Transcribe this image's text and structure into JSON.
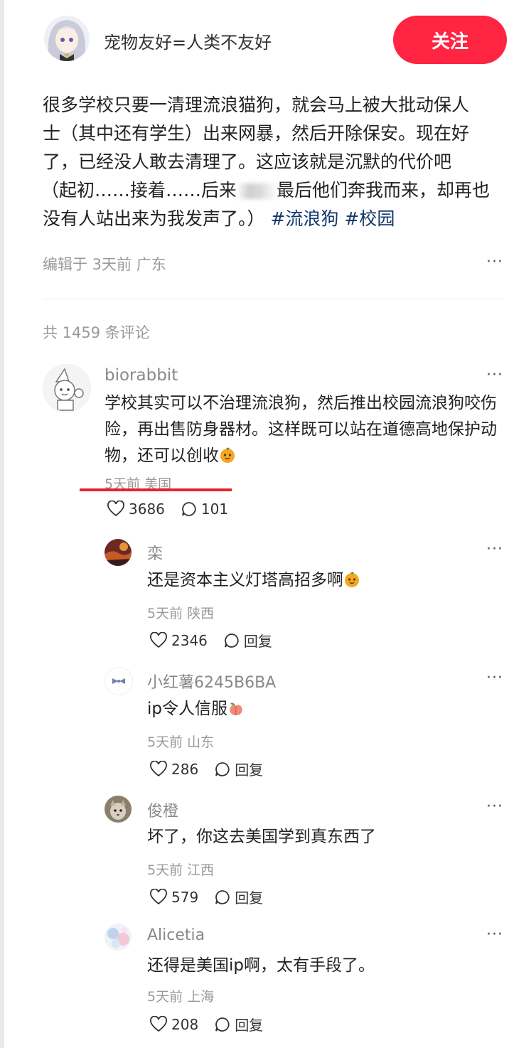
{
  "post": {
    "author": "宠物友好=人类不友好",
    "follow_label": "关注",
    "lines": [
      "很多学校只要一清理流浪猫狗，就会马上被大批动保人",
      "士（其中还有学生）出来网暴，然后开除保安。现在好",
      "了，已经没人敢去清理了。这应该就是沉默的代价吧",
      "（起初……接着……后来",
      "最后他们奔我而来，却再也",
      "没有人站出来为我发声了。）"
    ],
    "tags": [
      "#流浪狗",
      "#校园"
    ],
    "meta": "编辑于 3天前 广东",
    "more": "···"
  },
  "comments_header": "共 1459 条评论",
  "comments": [
    {
      "name": "biorabbit",
      "lines": [
        "学校其实可以不治理流浪狗，然后推出校园流浪狗咬伤",
        "险，再出售防身器材。这样既可以站在道德高地保护动",
        "物，还可以创收"
      ],
      "meta": "5天前 美国",
      "likes": "3686",
      "replies": "101",
      "more": "···"
    }
  ],
  "replies": [
    {
      "name": "栾",
      "text": "还是资本主义灯塔高招多啊",
      "meta": "5天前 陕西",
      "likes": "2346",
      "reply_label": "回复",
      "more": "···"
    },
    {
      "name": "小红薯6245B6BA",
      "text": "ip令人信服",
      "meta": "5天前 山东",
      "likes": "286",
      "reply_label": "回复",
      "more": "···"
    },
    {
      "name": "俊橙",
      "text": "坏了，你这去美国学到真东西了",
      "meta": "5天前 江西",
      "likes": "579",
      "reply_label": "回复",
      "more": "···"
    },
    {
      "name": "Alicetia",
      "text": "还得是美国ip啊，太有手段了。",
      "meta": "5天前 上海",
      "likes": "208",
      "reply_label": "回复",
      "more": "···"
    }
  ],
  "colors": {
    "accent": "#ff2442",
    "tag": "#13386c",
    "underline": "#e8232a"
  }
}
